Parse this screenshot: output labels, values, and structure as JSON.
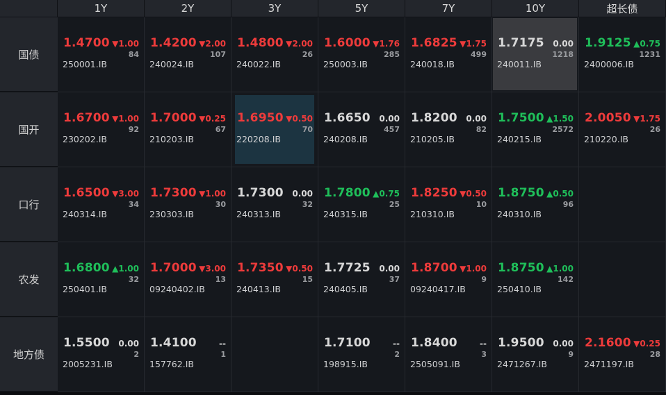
{
  "columns": [
    "1Y",
    "2Y",
    "3Y",
    "5Y",
    "7Y",
    "10Y",
    "超长债"
  ],
  "rows": [
    {
      "label": "国债",
      "cells": [
        {
          "yield": "1.4700",
          "change": "▼1.00",
          "volume": "84",
          "code": "250001.IB",
          "color": "red",
          "highlight": ""
        },
        {
          "yield": "1.4200",
          "change": "▼2.00",
          "volume": "107",
          "code": "240024.IB",
          "color": "red",
          "highlight": ""
        },
        {
          "yield": "1.4800",
          "change": "▼2.00",
          "volume": "26",
          "code": "240022.IB",
          "color": "red",
          "highlight": ""
        },
        {
          "yield": "1.6000",
          "change": "▼1.76",
          "volume": "285",
          "code": "250003.IB",
          "color": "red",
          "highlight": ""
        },
        {
          "yield": "1.6825",
          "change": "▼1.75",
          "volume": "499",
          "code": "240018.IB",
          "color": "red",
          "highlight": ""
        },
        {
          "yield": "1.7175",
          "change": "0.00",
          "volume": "1218",
          "code": "240011.IB",
          "color": "white",
          "highlight": "gray"
        },
        {
          "yield": "1.9125",
          "change": "▲0.75",
          "volume": "1231",
          "code": "2400006.IB",
          "color": "green",
          "highlight": ""
        }
      ]
    },
    {
      "label": "国开",
      "cells": [
        {
          "yield": "1.6700",
          "change": "▼1.00",
          "volume": "92",
          "code": "230202.IB",
          "color": "red",
          "highlight": ""
        },
        {
          "yield": "1.7000",
          "change": "▼0.25",
          "volume": "67",
          "code": "210203.IB",
          "color": "red",
          "highlight": ""
        },
        {
          "yield": "1.6950",
          "change": "▼0.50",
          "volume": "70",
          "code": "220208.IB",
          "color": "red",
          "highlight": "blue"
        },
        {
          "yield": "1.6650",
          "change": "0.00",
          "volume": "457",
          "code": "240208.IB",
          "color": "white",
          "highlight": ""
        },
        {
          "yield": "1.8200",
          "change": "0.00",
          "volume": "82",
          "code": "210205.IB",
          "color": "white",
          "highlight": ""
        },
        {
          "yield": "1.7500",
          "change": "▲1.50",
          "volume": "2572",
          "code": "240215.IB",
          "color": "green",
          "highlight": ""
        },
        {
          "yield": "2.0050",
          "change": "▼1.75",
          "volume": "26",
          "code": "210220.IB",
          "color": "red",
          "highlight": ""
        }
      ]
    },
    {
      "label": "口行",
      "cells": [
        {
          "yield": "1.6500",
          "change": "▼3.00",
          "volume": "34",
          "code": "240314.IB",
          "color": "red",
          "highlight": ""
        },
        {
          "yield": "1.7300",
          "change": "▼1.00",
          "volume": "30",
          "code": "230303.IB",
          "color": "red",
          "highlight": ""
        },
        {
          "yield": "1.7300",
          "change": "0.00",
          "volume": "32",
          "code": "240313.IB",
          "color": "white",
          "highlight": ""
        },
        {
          "yield": "1.7800",
          "change": "▲0.75",
          "volume": "25",
          "code": "240315.IB",
          "color": "green",
          "highlight": ""
        },
        {
          "yield": "1.8250",
          "change": "▼0.50",
          "volume": "10",
          "code": "210310.IB",
          "color": "red",
          "highlight": ""
        },
        {
          "yield": "1.8750",
          "change": "▲0.50",
          "volume": "96",
          "code": "240310.IB",
          "color": "green",
          "highlight": ""
        },
        null
      ]
    },
    {
      "label": "农发",
      "cells": [
        {
          "yield": "1.6800",
          "change": "▲1.00",
          "volume": "32",
          "code": "250401.IB",
          "color": "green",
          "highlight": ""
        },
        {
          "yield": "1.7000",
          "change": "▼3.00",
          "volume": "13",
          "code": "09240402.IB",
          "color": "red",
          "highlight": ""
        },
        {
          "yield": "1.7350",
          "change": "▼0.50",
          "volume": "15",
          "code": "240413.IB",
          "color": "red",
          "highlight": ""
        },
        {
          "yield": "1.7725",
          "change": "0.00",
          "volume": "37",
          "code": "240405.IB",
          "color": "white",
          "highlight": ""
        },
        {
          "yield": "1.8700",
          "change": "▼1.00",
          "volume": "9",
          "code": "09240417.IB",
          "color": "red",
          "highlight": ""
        },
        {
          "yield": "1.8750",
          "change": "▲1.00",
          "volume": "142",
          "code": "250410.IB",
          "color": "green",
          "highlight": ""
        },
        null
      ]
    },
    {
      "label": "地方债",
      "cells": [
        {
          "yield": "1.5500",
          "change": "0.00",
          "volume": "2",
          "code": "2005231.IB",
          "color": "white",
          "highlight": ""
        },
        {
          "yield": "1.4100",
          "change": "--",
          "volume": "1",
          "code": "157762.IB",
          "color": "white",
          "highlight": ""
        },
        null,
        {
          "yield": "1.7100",
          "change": "--",
          "volume": "2",
          "code": "198915.IB",
          "color": "white",
          "highlight": ""
        },
        {
          "yield": "1.8400",
          "change": "--",
          "volume": "3",
          "code": "2505091.IB",
          "color": "white",
          "highlight": ""
        },
        {
          "yield": "1.9500",
          "change": "0.00",
          "volume": "9",
          "code": "2471267.IB",
          "color": "white",
          "highlight": ""
        },
        {
          "yield": "2.1600",
          "change": "▼0.25",
          "volume": "28",
          "code": "2471197.IB",
          "color": "red",
          "highlight": ""
        }
      ]
    }
  ],
  "colors": {
    "up": "#1fbf5a",
    "down": "#ee3b3b",
    "flat": "#d8d8d8",
    "background": "#15181d",
    "header": "#23262c"
  }
}
